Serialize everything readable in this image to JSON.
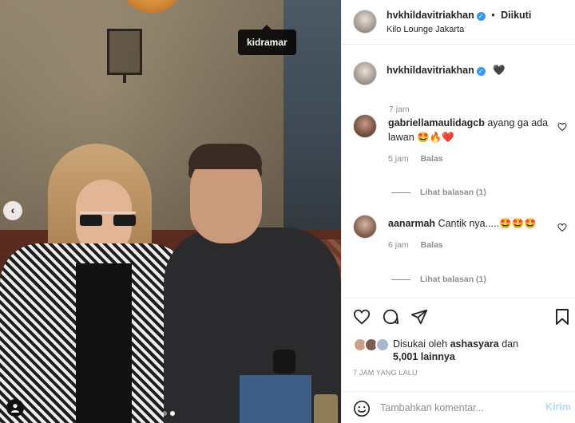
{
  "post_image": {
    "tag": "kidramar",
    "carousel_prev": "‹",
    "dots": 2,
    "active_dot": 1
  },
  "header": {
    "username": "hvkhildavitriakhan",
    "follow_separator": "•",
    "follow_status": "Diikuti",
    "location": "Kilo Lounge Jakarta"
  },
  "caption": {
    "username": "hvkhildavitriakhan",
    "text": "🖤",
    "time": "7 jam"
  },
  "comments": [
    {
      "username": "gabriellamaulidagcb",
      "text": "ayang ga ada lawan 🤩🔥❤️",
      "time": "5 jam",
      "reply_label": "Balas",
      "view_replies": "Lihat balasan (1)"
    },
    {
      "username": "aanarmah",
      "text": "Cantik nya.....🤩🤩🤩",
      "time": "6 jam",
      "reply_label": "Balas",
      "view_replies": "Lihat balasan (1)"
    }
  ],
  "likes": {
    "prefix": "Disukai oleh",
    "user": "ashasyara",
    "and": "dan",
    "others": "5,001 lainnya"
  },
  "timestamp": "7 JAM YANG LALU",
  "add_comment": {
    "placeholder": "Tambahkan komentar...",
    "post_label": "Kirim"
  },
  "colors": {
    "verified": "#3897f0",
    "post_button": "#b3dbff",
    "muted_text": "#8e8e8e"
  },
  "icons": [
    "heart-icon",
    "comment-icon",
    "share-icon",
    "bookmark-icon",
    "emoji-icon",
    "user-tag-icon",
    "chevron-left-icon"
  ]
}
